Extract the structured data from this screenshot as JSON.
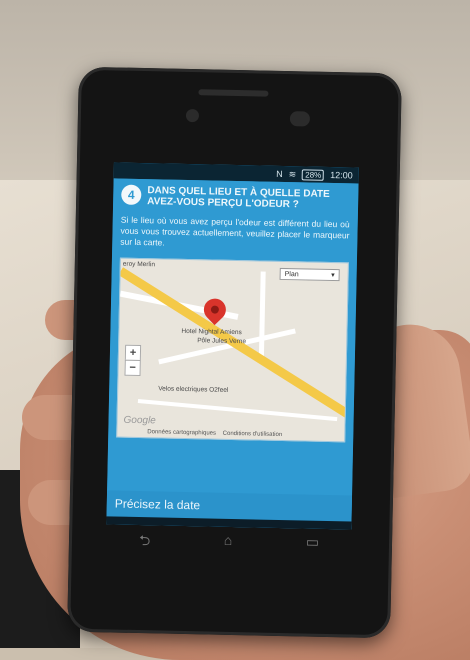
{
  "status_bar": {
    "icons": [
      "nfc-icon",
      "wifi-icon",
      "battery-icon"
    ],
    "battery": "28%",
    "time": "12:00"
  },
  "step": {
    "number": "4",
    "title": "DANS QUEL LIEU ET À QUELLE DATE AVEZ-VOUS PERÇU L'ODEUR ?",
    "description": "Si le lieu où vous avez perçu l'odeur est différent du lieu où vous vous trouvez actuellement, veuillez placer le marqueur sur la carte."
  },
  "map": {
    "view_select": "Plan",
    "zoom_in": "+",
    "zoom_out": "−",
    "labels": {
      "place1": "eroy Merlin",
      "place2": "Hotel Nightal Amiens",
      "place3": "Pôle Jules Verne",
      "place4": "Velos electriques O2feel"
    },
    "google": "Google",
    "footer_data": "Données cartographiques",
    "footer_terms": "Conditions d'utilisation"
  },
  "specify_date": "Précisez la date",
  "softkeys": {
    "back": "⮌",
    "home": "⌂",
    "recent": "▭"
  },
  "colors": {
    "accent": "#2f9ad2",
    "pin": "#d9342b",
    "road": "#f4c948"
  }
}
